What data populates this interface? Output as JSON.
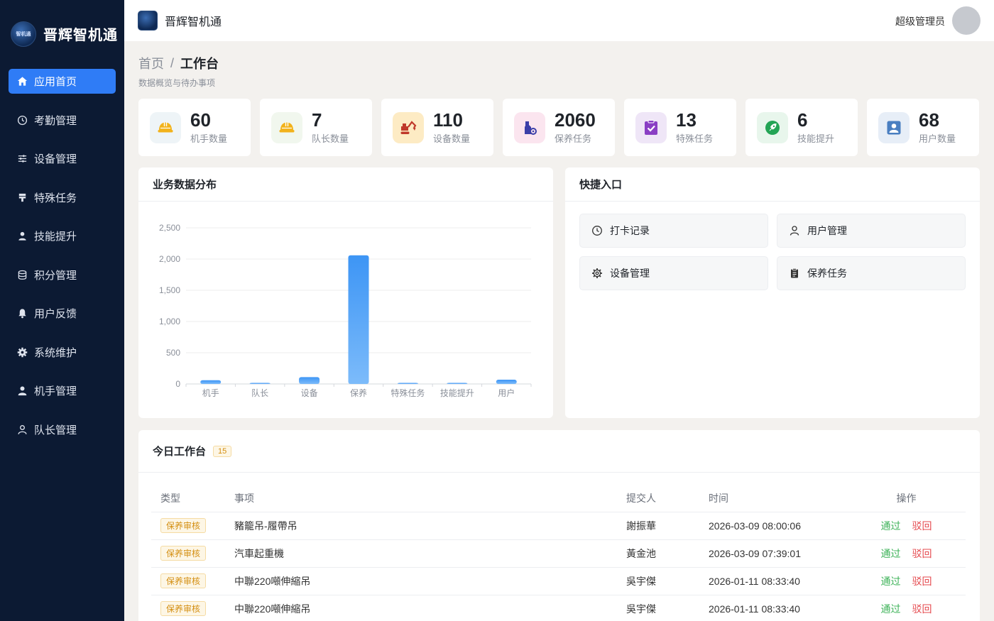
{
  "app": {
    "name": "晋辉智机通",
    "logo_text": "智机通"
  },
  "header": {
    "title": "晋辉智机通",
    "user_name": "超级管理员"
  },
  "sidebar": {
    "items": [
      {
        "label": "应用首页",
        "icon": "home-icon",
        "active": true
      },
      {
        "label": "考勤管理",
        "icon": "clock-icon"
      },
      {
        "label": "设备管理",
        "icon": "sliders-icon"
      },
      {
        "label": "特殊任务",
        "icon": "pin-icon"
      },
      {
        "label": "技能提升",
        "icon": "user-up-icon"
      },
      {
        "label": "积分管理",
        "icon": "database-icon"
      },
      {
        "label": "用户反馈",
        "icon": "bell-icon"
      },
      {
        "label": "系统维护",
        "icon": "gear-icon"
      },
      {
        "label": "机手管理",
        "icon": "person-icon"
      },
      {
        "label": "队长管理",
        "icon": "person-outline-icon"
      }
    ]
  },
  "breadcrumb": {
    "home": "首页",
    "separator": "/",
    "current": "工作台"
  },
  "subtitle": "数据概览与待办事项",
  "stats": [
    {
      "value": "60",
      "label": "机手数量",
      "icon": "helmet-icon",
      "bg": "#eef4f7",
      "color": "#f2b21b"
    },
    {
      "value": "7",
      "label": "队长数量",
      "icon": "helmet-icon",
      "bg": "#f1f7ee",
      "color": "#f2b21b"
    },
    {
      "value": "110",
      "label": "设备数量",
      "icon": "excavator-icon",
      "bg": "#fdebc4",
      "color": "#c0392b"
    },
    {
      "value": "2060",
      "label": "保养任务",
      "icon": "maintenance-icon",
      "bg": "#fbe5ef",
      "color": "#3b3fa8"
    },
    {
      "value": "13",
      "label": "特殊任务",
      "icon": "clipboard-check-icon",
      "bg": "#efe6f7",
      "color": "#8a3fc4"
    },
    {
      "value": "6",
      "label": "技能提升",
      "icon": "rocket-icon",
      "bg": "#e8f6ec",
      "color": "#23a455"
    },
    {
      "value": "68",
      "label": "用户数量",
      "icon": "user-card-icon",
      "bg": "#e7eef7",
      "color": "#4a7fc1"
    }
  ],
  "chart_panel": {
    "title": "业务数据分布"
  },
  "chart_data": {
    "type": "bar",
    "categories": [
      "机手",
      "队长",
      "设备",
      "保养",
      "特殊任务",
      "技能提升",
      "用户"
    ],
    "values": [
      60,
      7,
      110,
      2060,
      13,
      6,
      68
    ],
    "ylim": [
      0,
      2500
    ],
    "yticks": [
      0,
      500,
      1000,
      1500,
      2000,
      2500
    ],
    "ytick_labels": [
      "0",
      "500",
      "1,000",
      "1,500",
      "2,000",
      "2,500"
    ],
    "grid": true,
    "bar_color": "#4fa3f7"
  },
  "quick_panel": {
    "title": "快捷入口",
    "items": [
      {
        "label": "打卡记录",
        "icon": "clock-icon"
      },
      {
        "label": "用户管理",
        "icon": "user-icon"
      },
      {
        "label": "设备管理",
        "icon": "gear-icon"
      },
      {
        "label": "保养任务",
        "icon": "clipboard-icon"
      }
    ]
  },
  "today": {
    "title": "今日工作台",
    "count": "15",
    "columns": [
      "类型",
      "事项",
      "提交人",
      "时间",
      "操作"
    ],
    "rows": [
      {
        "type": "保养审核",
        "item": "豬籠吊-履帶吊",
        "submitter": "謝振華",
        "time": "2026-03-09 08:00:06"
      },
      {
        "type": "保养审核",
        "item": "汽車起重機",
        "submitter": "黃金池",
        "time": "2026-03-09 07:39:01"
      },
      {
        "type": "保养审核",
        "item": "中聯220噸伸縮吊",
        "submitter": "吳宇傑",
        "time": "2026-01-11 08:33:40"
      },
      {
        "type": "保养审核",
        "item": "中聯220噸伸縮吊",
        "submitter": "吳宇傑",
        "time": "2026-01-11 08:33:40"
      }
    ],
    "actions": {
      "pass": "通过",
      "reject": "驳回"
    }
  }
}
